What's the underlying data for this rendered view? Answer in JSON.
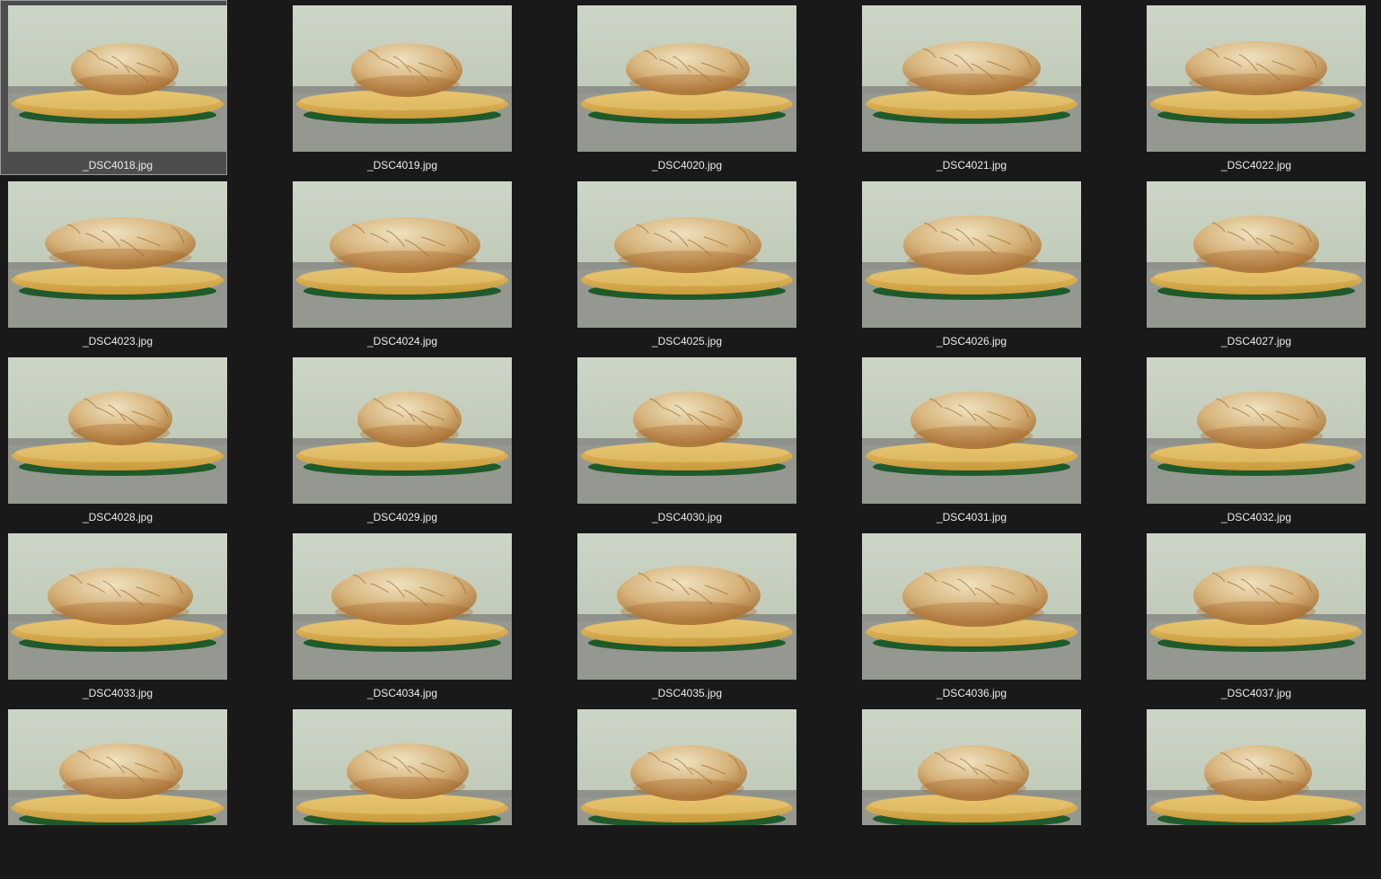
{
  "colors": {
    "background": "#191919",
    "selected_tile": "#4d4d4d",
    "label_text": "#ececec"
  },
  "selected_index": 0,
  "files": [
    {
      "name": "_DSC4018.jpg",
      "label": true
    },
    {
      "name": "_DSC4019.jpg",
      "label": true
    },
    {
      "name": "_DSC4020.jpg",
      "label": true
    },
    {
      "name": "_DSC4021.jpg",
      "label": true
    },
    {
      "name": "_DSC4022.jpg",
      "label": true
    },
    {
      "name": "_DSC4023.jpg",
      "label": true
    },
    {
      "name": "_DSC4024.jpg",
      "label": true
    },
    {
      "name": "_DSC4025.jpg",
      "label": true
    },
    {
      "name": "_DSC4026.jpg",
      "label": true
    },
    {
      "name": "_DSC4027.jpg",
      "label": true
    },
    {
      "name": "_DSC4028.jpg",
      "label": true
    },
    {
      "name": "_DSC4029.jpg",
      "label": true
    },
    {
      "name": "_DSC4030.jpg",
      "label": true
    },
    {
      "name": "_DSC4031.jpg",
      "label": true
    },
    {
      "name": "_DSC4032.jpg",
      "label": true
    },
    {
      "name": "_DSC4033.jpg",
      "label": true
    },
    {
      "name": "_DSC4034.jpg",
      "label": true
    },
    {
      "name": "_DSC4035.jpg",
      "label": true
    },
    {
      "name": "_DSC4036.jpg",
      "label": true
    },
    {
      "name": "_DSC4037.jpg",
      "label": true
    },
    {
      "name": "",
      "label": false
    },
    {
      "name": "",
      "label": false
    },
    {
      "name": "",
      "label": false
    },
    {
      "name": "",
      "label": false
    },
    {
      "name": "",
      "label": false
    }
  ]
}
